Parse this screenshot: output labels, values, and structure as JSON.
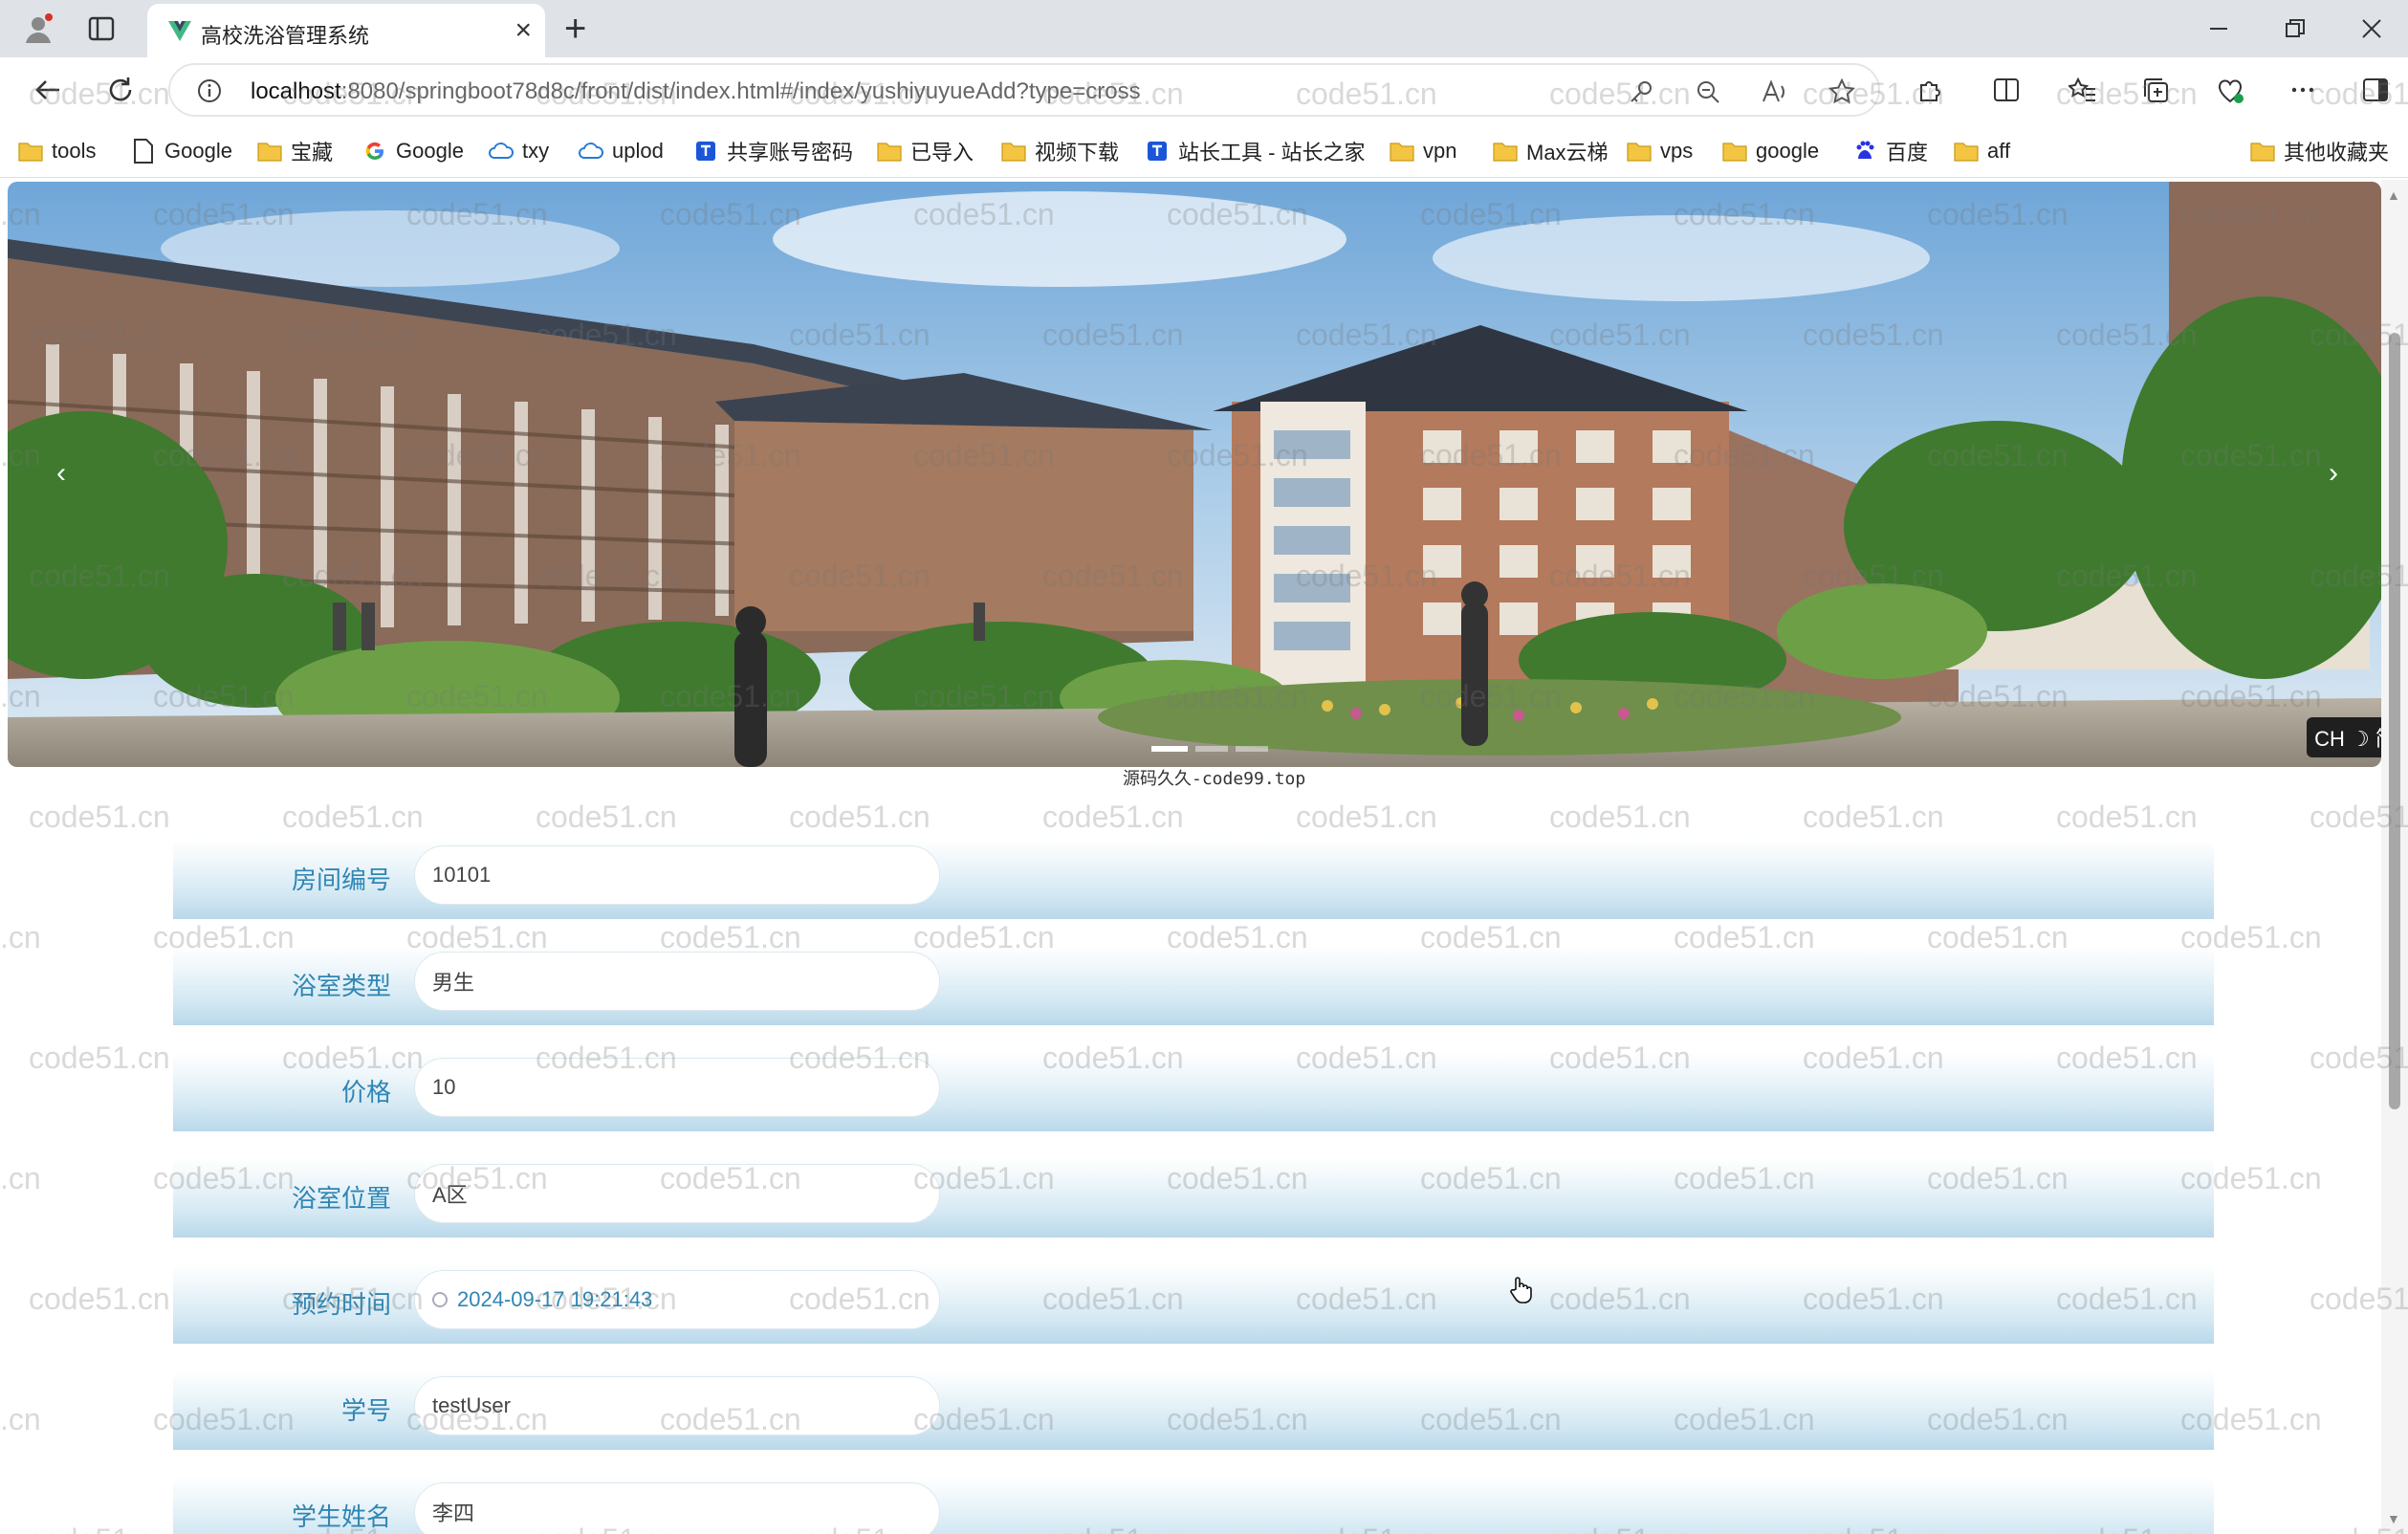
{
  "browser": {
    "tab_title": "高校洗浴管理系统",
    "url_host": "localhost",
    "url_rest": ":8080/springboot78d8c/front/dist/index.html#/index/yushiyuyueAdd?type=cross"
  },
  "bookmarks": [
    {
      "label": "tools",
      "icon": "folder-icon"
    },
    {
      "label": "Google",
      "icon": "page-icon"
    },
    {
      "label": "宝藏",
      "icon": "folder-icon"
    },
    {
      "label": "Google",
      "icon": "google-icon"
    },
    {
      "label": "txy",
      "icon": "cloud-icon"
    },
    {
      "label": "uplod",
      "icon": "cloud-icon"
    },
    {
      "label": "共享账号密码",
      "icon": "app-icon"
    },
    {
      "label": "已导入",
      "icon": "folder-icon"
    },
    {
      "label": "视频下载",
      "icon": "folder-icon"
    },
    {
      "label": "站长工具 - 站长之家",
      "icon": "app-icon"
    },
    {
      "label": "vpn",
      "icon": "folder-icon"
    },
    {
      "label": "Max云梯",
      "icon": "folder-icon"
    },
    {
      "label": "vps",
      "icon": "folder-icon"
    },
    {
      "label": "google",
      "icon": "folder-icon"
    },
    {
      "label": "百度",
      "icon": "baidu-icon"
    },
    {
      "label": "aff",
      "icon": "folder-icon"
    }
  ],
  "other_bookmarks": "其他收藏夹",
  "carousel": {
    "lang_badge": "CH ☽ 简",
    "caption": "源码久久-code99.top"
  },
  "form": {
    "fields": [
      {
        "label": "房间编号",
        "value": "10101"
      },
      {
        "label": "浴室类型",
        "value": "男生"
      },
      {
        "label": "价格",
        "value": "10"
      },
      {
        "label": "浴室位置",
        "value": "A区"
      },
      {
        "label": "预约时间",
        "value": "2024-09-17 19:21:43"
      },
      {
        "label": "学号",
        "value": "testUser"
      },
      {
        "label": "学生姓名",
        "value": "李四"
      }
    ]
  },
  "watermark": "code51.cn",
  "colors": {
    "label": "#2f86b4",
    "row_gradient_bottom": "#b9d8ea",
    "tabbar": "#dfe3e8"
  }
}
